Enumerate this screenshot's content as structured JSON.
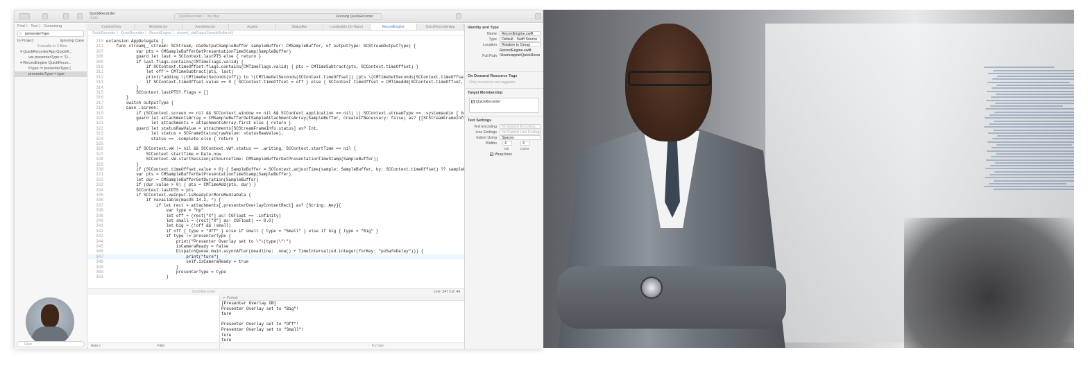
{
  "toolbar": {
    "scheme_name": "QuickRecorder",
    "scheme_sub": "main",
    "status_left": "QuickRecorder  〉  My Mac",
    "status_run": "Running QuickRecorder"
  },
  "navigator": {
    "mode": "Find 〉 Text 〉 Containing",
    "search_value": "presenterType",
    "scope": "In Project",
    "case_option": "Ignoring Case",
    "results_summary": "3 results in 2 files",
    "results": [
      {
        "label": "QuickRecorderApp  QuickR...",
        "type": "file"
      },
      {
        "label": "var presenterType = \"O...",
        "type": "item"
      },
      {
        "label": "RecordEngine  QuickRecor...",
        "type": "file"
      },
      {
        "label": "if type != presenterType {",
        "type": "item"
      },
      {
        "label": "presenterType = type",
        "type": "item"
      }
    ],
    "filter_placeholder": "Filter"
  },
  "editor": {
    "tabs": [
      "ContentView",
      "WinSelector",
      "AreaSelector",
      "Assets",
      "StatusBar",
      "Localizable (Xr-Hans)",
      "RecordEngine",
      "QuickRecorderApp"
    ],
    "active_tab": "RecordEngine",
    "jumpbar": "QuickRecorder 〉 QuickRecorder 〉 RecordEngine 〉 stream(_:didOutputSampleBuffer:of:)",
    "lines": [
      {
        "n": "210",
        "t": "extension AppDelegate {"
      },
      {
        "n": "211",
        "t": "    func stream(_ stream: SCStream, didOutputSampleBuffer sampleBuffer: CMSampleBuffer, of outputType: SCStreamOutputType) {"
      },
      {
        "n": "307",
        "t": "            var pts = CMSampleBufferGetPresentationTimeStamp(SampleBuffer)"
      },
      {
        "n": "308",
        "t": "            guard let last = SCContext.lastPTS else { return }"
      },
      {
        "n": "309",
        "t": "            if last.flags.contains(CMTimeFlags.valid) {"
      },
      {
        "n": "310",
        "t": "                if SCContext.timeOffset.flags.contains(CMTimeFlags.valid) { pts = CMTimeSubtract(pts, SCContext.timeOffset) }"
      },
      {
        "n": "311",
        "t": "                let off = CMTimeSubtract(pts, last)"
      },
      {
        "n": "312",
        "t": "                print(\"adding \\(CMTimeGetSeconds(off)) to \\(CMTimeGetSeconds(SCContext.timeOffset)) (pts \\(CMTimeGetSeconds(SCContext.timeOffset)))\")"
      },
      {
        "n": "313",
        "t": "                if SCContext.timeOffset.value == 0 { SCContext.timeOffset = off } else { SCContext.timeOffset = CMTimeAdd(SCContext.timeOffset, off) }"
      },
      {
        "n": "314",
        "t": "            }"
      },
      {
        "n": "315",
        "t": "            SCContext.lastPTS?.flags = []"
      },
      {
        "n": "316",
        "t": "        }"
      },
      {
        "n": "317",
        "t": "        switch outputType {"
      },
      {
        "n": "318",
        "t": "        case .screen:"
      },
      {
        "n": "319",
        "t": "            if (SCContext.screen == nil && SCContext.window == nil && SCContext.application == nil) || SCContext.streamType == .systemaudio { break }"
      },
      {
        "n": "320",
        "t": "            guard let attachmentsArray = CMSampleBufferGetSampleAttachmentsArray(SampleBuffer, createIfNecessary: false) as? [[SCStreamFrameInfo: Any]],"
      },
      {
        "n": "321",
        "t": "                  let attachments = attachmentsArray.first else { return }"
      },
      {
        "n": "322",
        "t": "            guard let statusRawValue = attachments[SCStreamFrameInfo.status] as? Int,"
      },
      {
        "n": "323",
        "t": "                  let status = SCFrameStatus(rawValue: statusRawValue),"
      },
      {
        "n": "324",
        "t": "                  status == .complete else { return }"
      },
      {
        "n": "325",
        "t": ""
      },
      {
        "n": "326",
        "t": "            if SCContext.vW != nil && SCContext.vW?.status == .writing, SCContext.startTime == nil {"
      },
      {
        "n": "327",
        "t": "                SCContext.startTime = Date.now"
      },
      {
        "n": "328",
        "t": "                SCContext.vW.startSession(atSourceTime: CMSampleBufferGetPresentationTimeStamp(SampleBuffer))"
      },
      {
        "n": "329",
        "t": "            }"
      },
      {
        "n": "330",
        "t": "            if (SCContext.timeOffset.value > 0) { SampleBuffer = SCContext.adjustTime(sample: SampleBuffer, by: SCContext.timeOffset) ?? sampleBuffer }"
      },
      {
        "n": "331",
        "t": "            var pts = CMSampleBufferGetPresentationTimeStamp(SampleBuffer)"
      },
      {
        "n": "332",
        "t": "            let dur = CMSampleBufferGetDuration(SampleBuffer)"
      },
      {
        "n": "333",
        "t": "            if (dur.value > 0) { pts = CMTimeAdd(pts, dur) }"
      },
      {
        "n": "334",
        "t": "            SCContext.lastPTS = pts"
      },
      {
        "n": "335",
        "t": "            if SCContext.vwInput.isReadyForMoreMediaData {"
      },
      {
        "n": "336",
        "t": "                if #available(macOS 14.2, *) {"
      },
      {
        "n": "337",
        "t": "                    if let rect = attachments[.presenterOverlayContentRect] as? [String: Any]{"
      },
      {
        "n": "338",
        "t": "                        var type = \"hp\""
      },
      {
        "n": "339",
        "t": "                        let off = (rect[\"X\"] as! CGFloat == .infinity)"
      },
      {
        "n": "340",
        "t": "                        let small = (rect[\"X\"] as! CGFloat) == 0.0)"
      },
      {
        "n": "341",
        "t": "                        let big = (!off && !small)"
      },
      {
        "n": "342",
        "t": "                        if off { type = \"Off\" } else if small { type = \"Small\" } else if big { type = \"Big\" }"
      },
      {
        "n": "343",
        "t": "                        if type != presenterType {"
      },
      {
        "n": "344",
        "t": "                            print(\"Presenter Overlay set to \\\"\\(type)\\\"!\")"
      },
      {
        "n": "345",
        "t": "                            isCameraReady = false"
      },
      {
        "n": "346",
        "t": "                            DispatchQueue.main.asyncAfter(deadline: .now() + TimeInterval(ud.integer(forKey: \"poSafeDelay\"))) {"
      },
      {
        "n": "347",
        "t": "                                print(\"ture\")"
      },
      {
        "n": "348",
        "t": "                                self.isCameraReady = true"
      },
      {
        "n": "349",
        "t": "                            }"
      },
      {
        "n": "350",
        "t": "                            presenterType = type"
      },
      {
        "n": "351",
        "t": "                        }"
      }
    ],
    "current_line": "347",
    "line_col": "Line: 347  Col: 44"
  },
  "debug": {
    "target": "QuickRecorder",
    "auto_label": "Auto ◊",
    "filter_placeholder": "Filter",
    "console_header": "⊳ Portrait",
    "console_lines": [
      "[Presenter Overlay ON]",
      "Presenter Overlay set to \"Big\"!",
      "ture",
      "",
      "Presenter Overlay set to \"Off\"!",
      "Presenter Overlay set to \"Small\"!",
      "ture",
      "ture"
    ],
    "console_filter": "Filter"
  },
  "inspector": {
    "identity_title": "Identity and Type",
    "name_label": "Name",
    "name_value": "RecordEngine.swift",
    "type_label": "Type",
    "type_value": "Default - Swift Source",
    "location_label": "Location",
    "location_value": "Relative to Group",
    "location_file": "RecordEngine.swift",
    "fullpath_label": "Full Path",
    "fullpath_value": "/Users/apple/QuickRecorder/QuickRecorder/RecordEngine.swift",
    "ondemand_title": "On Demand Resource Tags",
    "ondemand_placeholder": "Only resources are taggable",
    "target_title": "Target Membership",
    "target_item": "QuickRecorder",
    "text_title": "Text Settings",
    "encoding_label": "Text Encoding",
    "encoding_value": "No Explicit Encoding",
    "endings_label": "Line Endings",
    "endings_value": "No Explicit Line Endings",
    "indent_label": "Indent Using",
    "indent_value": "Spaces",
    "widths_label": "Widths",
    "tab_label": "Tab",
    "tab_value": "4",
    "indent_w_label": "Indent",
    "indent_w_value": "4",
    "wrap_label": "Wrap lines"
  }
}
